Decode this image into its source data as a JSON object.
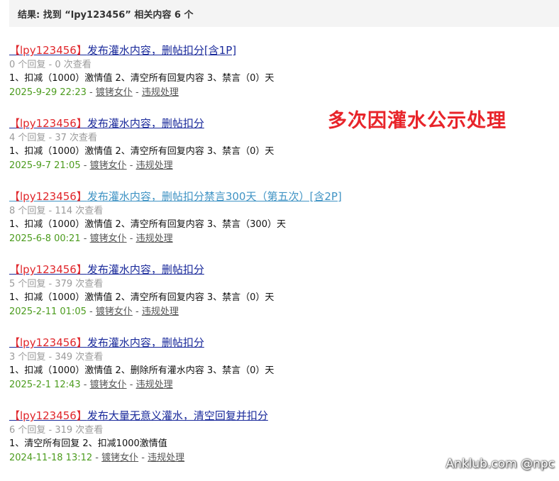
{
  "result_bar": {
    "text": "结果: 找到 “lpy123456” 相关内容 6 个"
  },
  "overlay_note": "多次因灌水公示处理",
  "watermark": "Anklub.com @npc",
  "items": [
    {
      "user_tag": "【lpy123456】",
      "title": "发布灌水内容，删帖扣分[含1P]",
      "stats": "0 个回复 - 0 次查看",
      "penalty": "1、扣减（1000）激情值 2、清空所有回复内容 3、禁言（0）天",
      "date": "2025-9-29 22:23",
      "sep1": " - ",
      "author": "镀铐女仆",
      "sep2": " - ",
      "category": "违规处理",
      "visited": false
    },
    {
      "user_tag": "【lpy123456】",
      "title": "发布灌水内容，删帖扣分",
      "stats": "4 个回复 - 37 次查看",
      "penalty": "1、扣减（1000）激情值 2、清空所有回复内容 3、禁言（0）天",
      "date": "2025-9-7 21:05",
      "sep1": " - ",
      "author": "镀铐女仆",
      "sep2": " - ",
      "category": "违规处理",
      "visited": false
    },
    {
      "user_tag": "【lpy123456】",
      "title": "发布灌水内容，删帖扣分禁言300天（第五次）[含2P]",
      "stats": "8 个回复 - 114 次查看",
      "penalty": "1、扣减（1000）激情值 2、清空所有回复内容 3、禁言（300）天",
      "date": "2025-6-8 00:21",
      "sep1": " - ",
      "author": "镀铐女仆",
      "sep2": " - ",
      "category": "违规处理",
      "visited": true
    },
    {
      "user_tag": "【lpy123456】",
      "title": "发布灌水内容，删帖扣分",
      "stats": "5 个回复 - 379 次查看",
      "penalty": "1、扣减（1000）激情值 2、清空所有回复内容 3、禁言（0）天",
      "date": "2025-2-11 01:05",
      "sep1": " - ",
      "author": "镀铐女仆",
      "sep2": " - ",
      "category": "违规处理",
      "visited": false
    },
    {
      "user_tag": "【lpy123456】",
      "title": "发布灌水内容，删帖扣分",
      "stats": "3 个回复 - 349 次查看",
      "penalty": "1、扣减（1000）激情值 2、删除所有灌水内容 3、禁言（0）天",
      "date": "2025-2-1 12:43",
      "sep1": " - ",
      "author": "镀铐女仆",
      "sep2": " - ",
      "category": "违规处理",
      "visited": false
    },
    {
      "user_tag": "【lpy123456】",
      "title": "发布大量无意义灌水，清空回复并扣分",
      "stats": "6 个回复 - 319 次查看",
      "penalty": "1、清空所有回复 2、扣减1000激情值",
      "date": "2024-11-18 13:12",
      "sep1": " - ",
      "author": "镀铐女仆",
      "sep2": " - ",
      "category": "违规处理",
      "visited": false
    }
  ]
}
